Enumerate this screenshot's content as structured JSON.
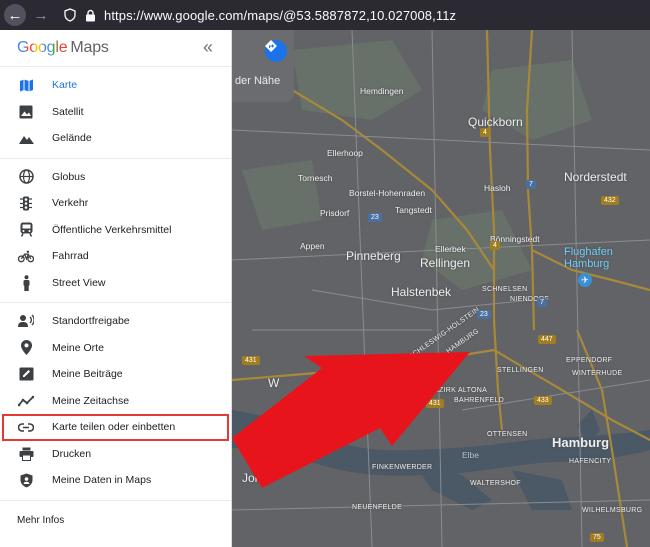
{
  "browser": {
    "url": "https://www.google.com/maps/@53.5887872,10.027008,11z",
    "back_icon": "arrow-left-icon",
    "forward_icon": "arrow-right-icon"
  },
  "menu": {
    "logo_google": "Google",
    "logo_maps": "Maps",
    "map_types": [
      {
        "label": "Karte",
        "icon": "map-icon",
        "active": true
      },
      {
        "label": "Satellit",
        "icon": "image-icon"
      },
      {
        "label": "Gelände",
        "icon": "terrain-icon"
      }
    ],
    "layers": [
      {
        "label": "Globus",
        "icon": "globe-icon"
      },
      {
        "label": "Verkehr",
        "icon": "traffic-light-icon"
      },
      {
        "label": "Öffentliche Verkehrsmittel",
        "icon": "train-icon"
      },
      {
        "label": "Fahrrad",
        "icon": "bicycle-icon"
      },
      {
        "label": "Street View",
        "icon": "pegman-icon"
      }
    ],
    "personal": [
      {
        "label": "Standortfreigabe",
        "icon": "location-sharing-icon"
      },
      {
        "label": "Meine Orte",
        "icon": "pin-icon"
      },
      {
        "label": "Meine Beiträge",
        "icon": "edit-icon"
      },
      {
        "label": "Meine Zeitachse",
        "icon": "timeline-icon"
      },
      {
        "label": "Karte teilen oder einbetten",
        "icon": "link-icon",
        "highlight": true
      },
      {
        "label": "Drucken",
        "icon": "print-icon"
      },
      {
        "label": "Meine Daten in Maps",
        "icon": "shield-user-icon"
      }
    ],
    "more_info": "Mehr Infos"
  },
  "map": {
    "nearby_text": "der Nähe",
    "labels": {
      "hemdingen": "Hemdingen",
      "ellerhoop": "Ellerhoop",
      "quickborn": "Quickborn",
      "norderstedt": "Norderstedt",
      "tornesch": "Tornesch",
      "borstel": "Borstel-Hohenraden",
      "hasloh": "Hasloh",
      "prisdorf": "Prisdorf",
      "tangstedt": "Tangstedt",
      "appen": "Appen",
      "ellerbek": "Ellerbek",
      "boenningstedt": "Bönningstedt",
      "pinneberg": "Pinneberg",
      "rellingen": "Rellingen",
      "flughafen": "Flughafen",
      "hamburg_air": "Hamburg",
      "halstenbek": "Halstenbek",
      "schnelsen": "SCHNELSEN",
      "niendorf": "NIENDORF",
      "schleswig": "SCHLESWIG-HOLSTEIN",
      "hamburg_state": "HAMBURG",
      "eppendorf": "EPPENDORF",
      "rissen": "RISSEN",
      "stellingen": "STELLINGEN",
      "winterhude": "WINTERHUDE",
      "bezirk_altona": "BEZIRK ALTONA",
      "bahrenfeld": "BAHRENFELD",
      "blankenese": "BLANKENESE",
      "ottensen": "OTTENSEN",
      "hamburg": "Hamburg",
      "hafencity": "HAFENCITY",
      "elbe": "Elbe",
      "jork": "Jork",
      "finkenwerder": "FINKENWERDER",
      "waltershof": "WALTERSHOF",
      "neuenfelde": "NEUENFELDE",
      "wilhelmsburg": "WILHELMSBURG",
      "w": "W"
    },
    "shields": {
      "s4a": "4",
      "s4b": "4",
      "s7a": "7",
      "s7b": "7",
      "s23a": "23",
      "s23b": "23",
      "s432": "432",
      "s447": "447",
      "s431a": "431",
      "s431b": "431",
      "s433": "433",
      "s75": "75"
    }
  }
}
